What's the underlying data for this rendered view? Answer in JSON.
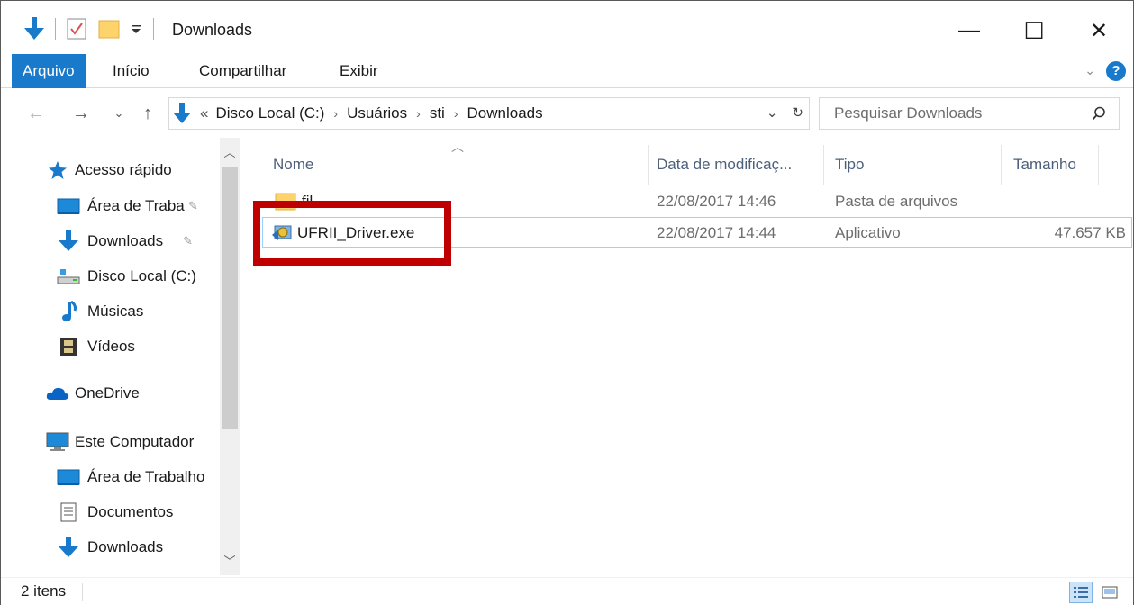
{
  "window": {
    "title": "Downloads",
    "minimize_glyph": "—",
    "maximize_glyph": "☐",
    "close_glyph": "✕"
  },
  "ribbon": {
    "tabs": [
      {
        "label": "Arquivo",
        "active": true
      },
      {
        "label": "Início"
      },
      {
        "label": "Compartilhar"
      },
      {
        "label": "Exibir"
      }
    ],
    "help": "?",
    "collapse_glyph": "⌄"
  },
  "address": {
    "overflow": "«",
    "crumbs": [
      "Disco Local (C:)",
      "Usuários",
      "sti",
      "Downloads"
    ],
    "separator": "›",
    "dropdown_glyph": "⌄",
    "refresh_glyph": "↻",
    "search_placeholder": "Pesquisar Downloads"
  },
  "nav": {
    "items": [
      {
        "label": "Acesso rápido",
        "icon": "star-icon"
      },
      {
        "label": "Área de Trabalho",
        "icon": "desktop-icon",
        "pinned": true
      },
      {
        "label": "Downloads",
        "icon": "download-arrow-icon",
        "pinned": true
      },
      {
        "label": "Disco Local (C:)",
        "icon": "drive-icon"
      },
      {
        "label": "Músicas",
        "icon": "music-note-icon"
      },
      {
        "label": "Vídeos",
        "icon": "film-icon"
      },
      {
        "label": "OneDrive",
        "icon": "cloud-icon"
      },
      {
        "label": "Este Computador",
        "icon": "computer-icon"
      },
      {
        "label": "Área de Trabalho",
        "icon": "desktop-icon"
      },
      {
        "label": "Documentos",
        "icon": "document-icon"
      },
      {
        "label": "Downloads",
        "icon": "download-arrow-icon"
      }
    ],
    "pin_glyph": "📌"
  },
  "columns": {
    "name": "Nome",
    "date": "Data de modificaç...",
    "type": "Tipo",
    "size": "Tamanho"
  },
  "files": [
    {
      "name": "fil",
      "date": "22/08/2017 14:46",
      "type": "Pasta de arquivos",
      "size": "",
      "icon": "folder-icon"
    },
    {
      "name": "UFRII_Driver.exe",
      "date": "22/08/2017 14:44",
      "type": "Aplicativo",
      "size": "47.657 KB",
      "icon": "installer-icon",
      "selected": true
    }
  ],
  "status": {
    "count": "2 itens"
  },
  "colors": {
    "accent": "#1979ca",
    "highlight_box": "#c00000",
    "selection_border": "#99d1ff",
    "column_header_text": "#4c607a"
  }
}
